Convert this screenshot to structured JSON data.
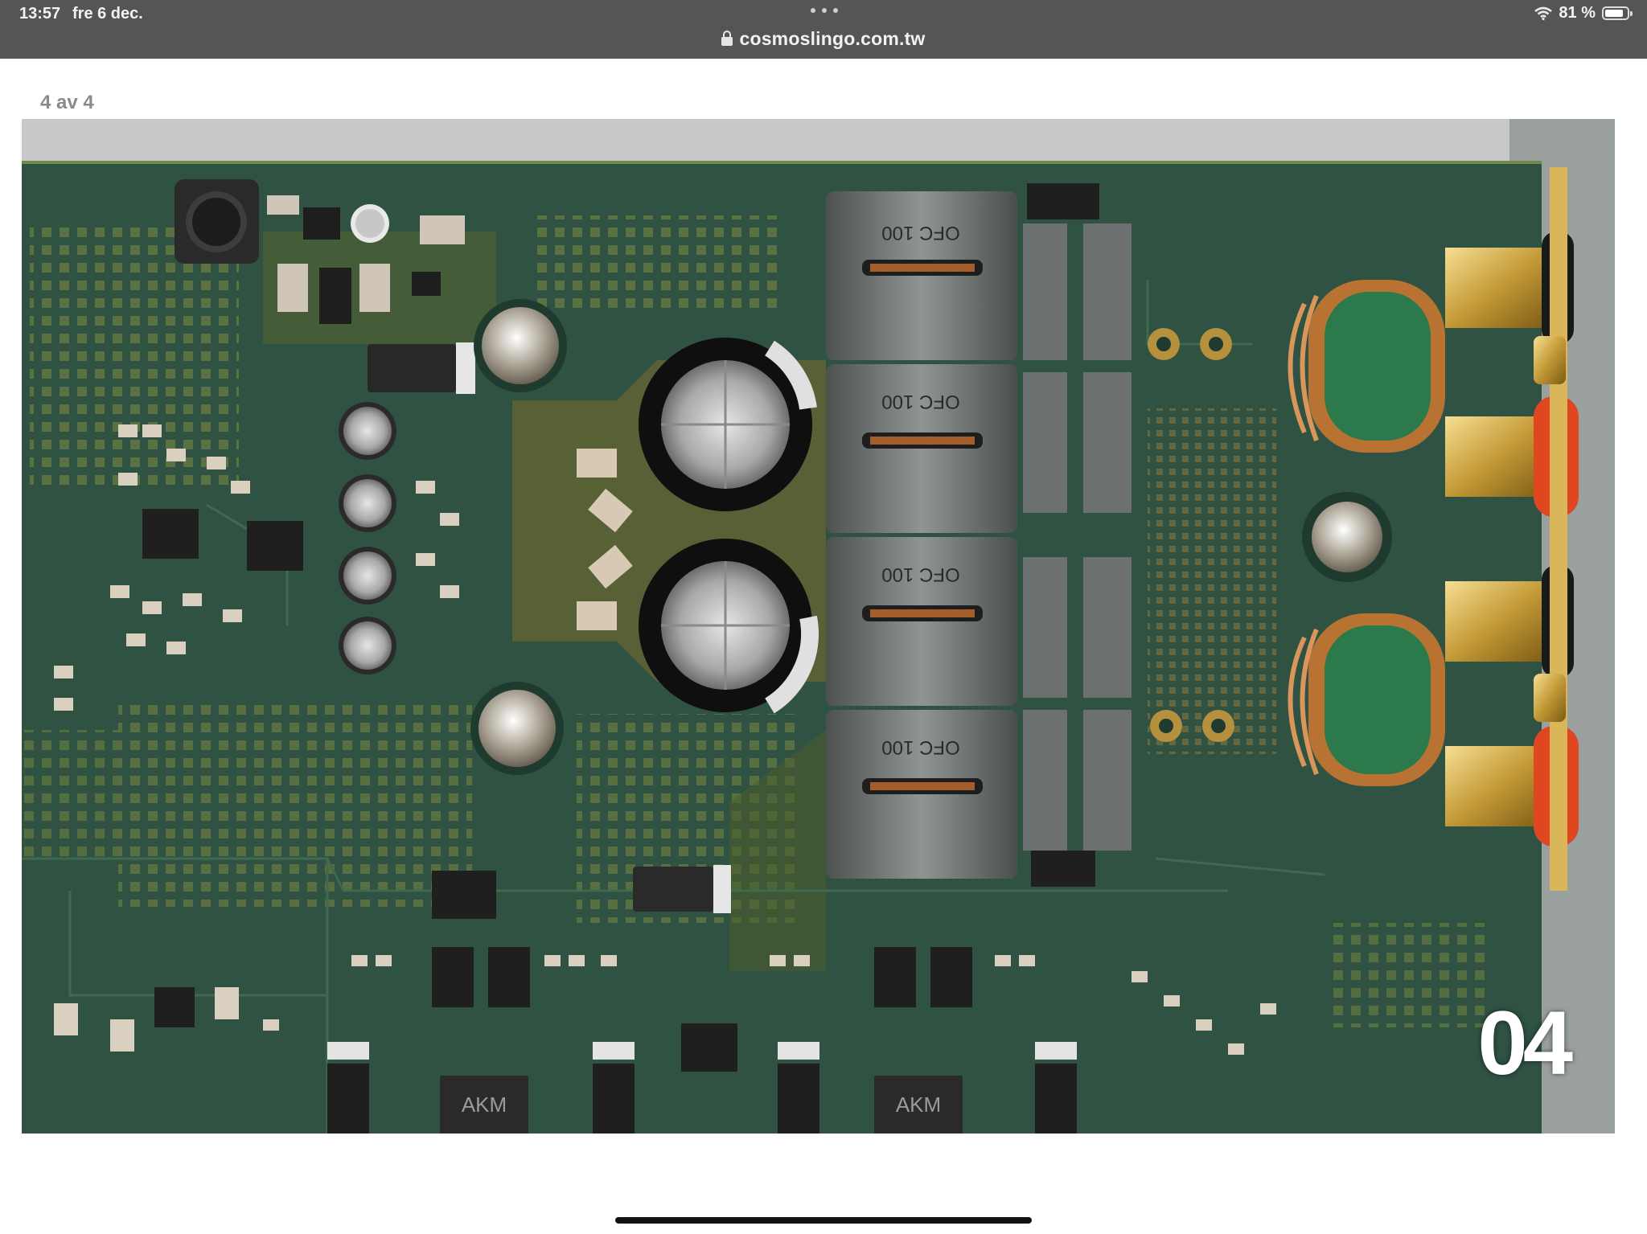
{
  "status_bar": {
    "time": "13:57",
    "date": "fre 6 dec.",
    "battery": "81 %"
  },
  "address_bar": {
    "url": "cosmoslingo.com.tw"
  },
  "gallery": {
    "counter": "4 av 4",
    "photo_number": "04",
    "photo_labels": {
      "cap1": "OFC 100",
      "cap2": "OFC 100",
      "cap3": "OFC 100",
      "cap4": "OFC 100",
      "chip1": "AKM",
      "chip2": "AKM"
    }
  },
  "colors": {
    "topbar": "#555555",
    "pcb": "#2f5243",
    "copper": "#b87333",
    "toroid_core": "#2c7a4b"
  }
}
